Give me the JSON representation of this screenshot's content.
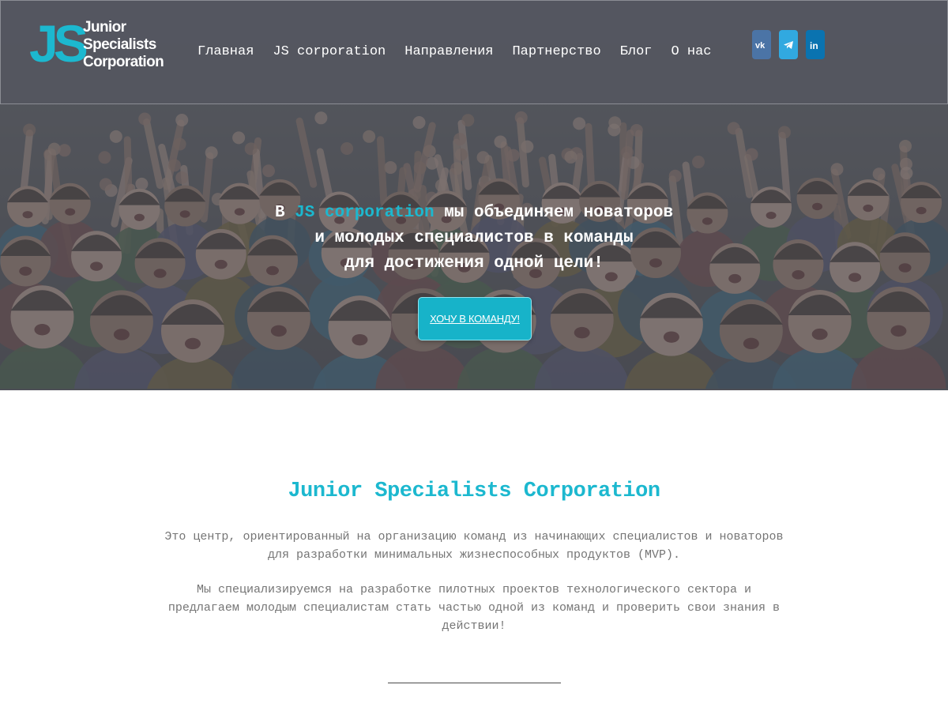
{
  "header": {
    "logo_mark": "JS",
    "logo_lines": [
      "Junior",
      "Specialists",
      "Corporation"
    ],
    "nav": [
      "Главная",
      "JS corporation",
      "Направления",
      "Партнерство",
      "Блог",
      "О нас"
    ],
    "social": [
      {
        "icon": "vk-icon",
        "label": "vk",
        "color": "#4b74a6"
      },
      {
        "icon": "telegram-icon",
        "label": "telegram",
        "color": "#31a9e0"
      },
      {
        "icon": "linkedin-icon",
        "label": "in",
        "color": "#0a73b0"
      }
    ]
  },
  "hero": {
    "line1_pre": "В ",
    "line1_accent": "JS corporation",
    "line1_post": " мы объединяем новаторов",
    "line2": "и молодых специалистов в команды",
    "line3": "для достижения одной цели!",
    "cta": "ХОЧУ В КОМАНДУ!"
  },
  "about": {
    "title": "Junior Specialists Corporation",
    "p1": "Это центр, ориентированный на организацию команд из начинающих специалистов и новаторов для разработки минимальных жизнеспособных продуктов (MVP).",
    "p2": "Мы специализируемся на разработке пилотных проектов технологического сектора и предлагаем молодым специалистам стать частью одной из команд и проверить свои знания в действии!"
  },
  "colors": {
    "accent": "#1cb8cf",
    "header_bg": "#545660",
    "body_text": "#757575"
  }
}
